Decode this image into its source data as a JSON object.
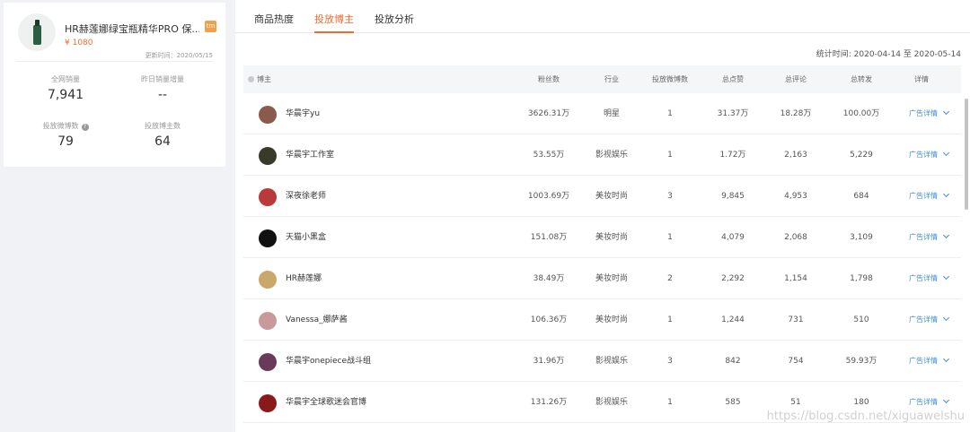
{
  "product": {
    "title": "HR赫莲娜绿宝瓶精华PRO 保...",
    "tag": "tm",
    "price": "¥ 1080",
    "update_time": "更新时间：2020/05/15",
    "stats": [
      {
        "label": "全网销量",
        "value": "7,941"
      },
      {
        "label": "昨日销量增量",
        "value": "--"
      },
      {
        "label": "投放微博数",
        "value": "79"
      },
      {
        "label": "投放博主数",
        "value": "64"
      }
    ]
  },
  "tabs": [
    "商品热度",
    "投放博主",
    "投放分析"
  ],
  "active_tab": 1,
  "stat_time": "统计时间: 2020-04-14 至 2020-05-14",
  "table": {
    "headers": [
      "博主",
      "粉丝数",
      "行业",
      "投放微博数",
      "总点赞",
      "总评论",
      "总转发",
      "详情"
    ],
    "rows": [
      {
        "name": "华晨宇yu",
        "fans": "3626.31万",
        "industry": "明星",
        "posts": "1",
        "likes": "31.37万",
        "comments": "18.28万",
        "reposts": "100.00万",
        "detail": "广告详情",
        "avatar_color": "#8a5a4e"
      },
      {
        "name": "华晨宇工作室",
        "fans": "53.55万",
        "industry": "影视娱乐",
        "posts": "1",
        "likes": "1.72万",
        "comments": "2,163",
        "reposts": "5,229",
        "detail": "广告详情",
        "avatar_color": "#3a3a2a"
      },
      {
        "name": "深夜徐老师",
        "fans": "1003.69万",
        "industry": "美妆时尚",
        "posts": "3",
        "likes": "9,845",
        "comments": "4,953",
        "reposts": "684",
        "detail": "广告详情",
        "avatar_color": "#b83a3a"
      },
      {
        "name": "天猫小黑盒",
        "fans": "151.08万",
        "industry": "美妆时尚",
        "posts": "1",
        "likes": "4,079",
        "comments": "2,068",
        "reposts": "3,109",
        "detail": "广告详情",
        "avatar_color": "#111111"
      },
      {
        "name": "HR赫莲娜",
        "fans": "38.49万",
        "industry": "美妆时尚",
        "posts": "2",
        "likes": "2,292",
        "comments": "1,154",
        "reposts": "1,798",
        "detail": "广告详情",
        "avatar_color": "#c9a86a"
      },
      {
        "name": "Vanessa_娜萨酱",
        "fans": "106.36万",
        "industry": "美妆时尚",
        "posts": "1",
        "likes": "1,244",
        "comments": "731",
        "reposts": "510",
        "detail": "广告详情",
        "avatar_color": "#c89a9a"
      },
      {
        "name": "华晨宇onepiece战斗组",
        "fans": "31.96万",
        "industry": "影视娱乐",
        "posts": "3",
        "likes": "842",
        "comments": "754",
        "reposts": "59.93万",
        "detail": "广告详情",
        "avatar_color": "#6a3a5a"
      },
      {
        "name": "华晨宇全球歌迷会官博",
        "fans": "131.26万",
        "industry": "影视娱乐",
        "posts": "1",
        "likes": "585",
        "comments": "51",
        "reposts": "180",
        "detail": "广告详情",
        "avatar_color": "#8a1a1a"
      }
    ]
  },
  "watermark": "https://blog.csdn.net/xiguawelshu",
  "colors": {
    "accent": "#f26b2f",
    "link": "#3e8ce8"
  }
}
